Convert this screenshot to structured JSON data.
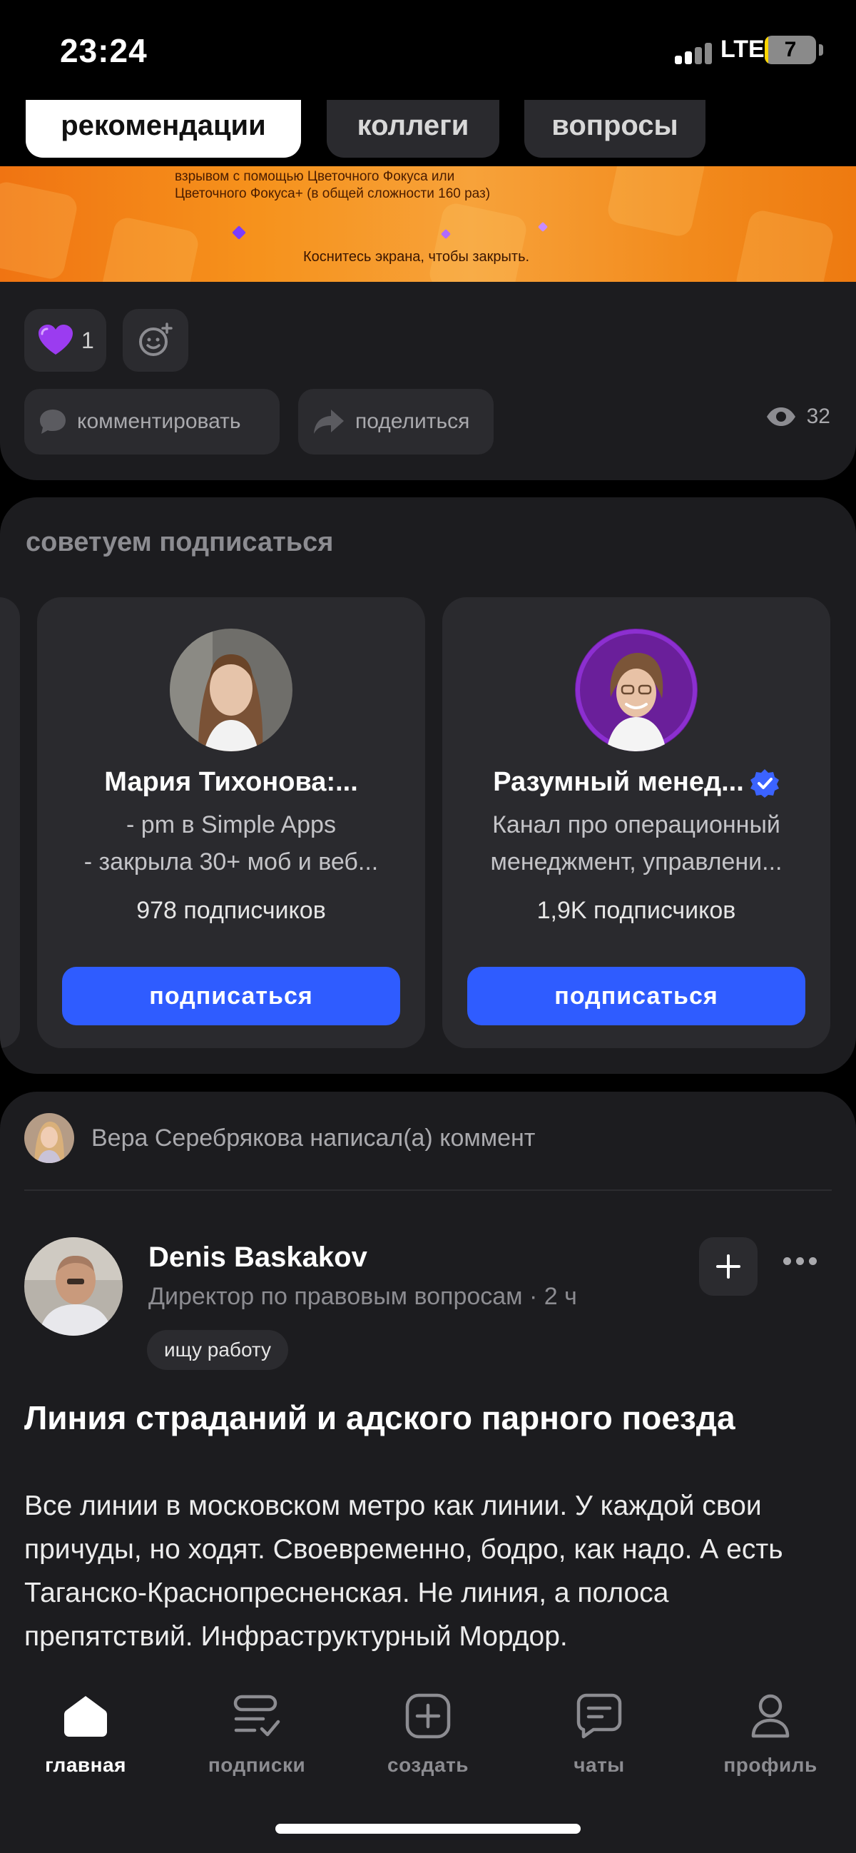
{
  "status_bar": {
    "time": "23:24",
    "network": "LTE",
    "battery": "7",
    "battery_level": 0.07
  },
  "top_tabs": [
    {
      "label": "рекомендации",
      "active": true
    },
    {
      "label": "коллеги",
      "active": false
    },
    {
      "label": "вопросы",
      "active": false
    }
  ],
  "banner": {
    "line1": "взрывом с помощью Цветочного Фокуса или",
    "line2": "Цветочного Фокуса+ (в общей сложности 160 раз)",
    "tap_hint": "Коснитесь экрана, чтобы закрыть."
  },
  "post_actions": {
    "reaction_count": "1",
    "comment_label": "комментировать",
    "share_label": "поделиться",
    "views": "32"
  },
  "recommend": {
    "title": "советуем подписаться",
    "cards": [
      {
        "name": "Мария Тихонова:...",
        "desc_line1": "- pm в Simple Apps",
        "desc_line2": "- закрыла 30+ моб и веб...",
        "subscribers": "978 подписчиков",
        "button": "подписаться",
        "verified": false
      },
      {
        "name": "Разумный менед...",
        "desc_line1": "Канал про операционный",
        "desc_line2": "менеджмент, управлени...",
        "subscribers": "1,9K подписчиков",
        "button": "подписаться",
        "verified": true
      }
    ]
  },
  "feed_post": {
    "comment_note": "Вера Серебрякова написал(а) коммент",
    "author_name": "Denis Baskakov",
    "author_role": "Директор по правовым вопросам · 2 ч",
    "job_tag": "ищу работу",
    "title": "Линия страданий и адского парного поезда",
    "body": "Все линии в московском метро как линии. У каждой свои причуды, но ходят. Своевременно, бодро, как надо. А есть Таганско-Краснопресненская. Не линия, а полоса препятствий. Инфраструктурный Мордор."
  },
  "bottom_nav": [
    {
      "label": "главная",
      "icon": "home-icon",
      "active": true
    },
    {
      "label": "подписки",
      "icon": "subscriptions-icon",
      "active": false
    },
    {
      "label": "создать",
      "icon": "create-plus-icon",
      "active": false
    },
    {
      "label": "чаты",
      "icon": "chat-icon",
      "active": false
    },
    {
      "label": "профиль",
      "icon": "profile-icon",
      "active": false
    }
  ],
  "colors": {
    "accent_blue": "#2f5cff",
    "card_bg": "#1c1c1f",
    "chip_bg": "#2b2b2f",
    "verified_blue": "#3b63ff",
    "reaction_heart": "#9b3cf0"
  }
}
